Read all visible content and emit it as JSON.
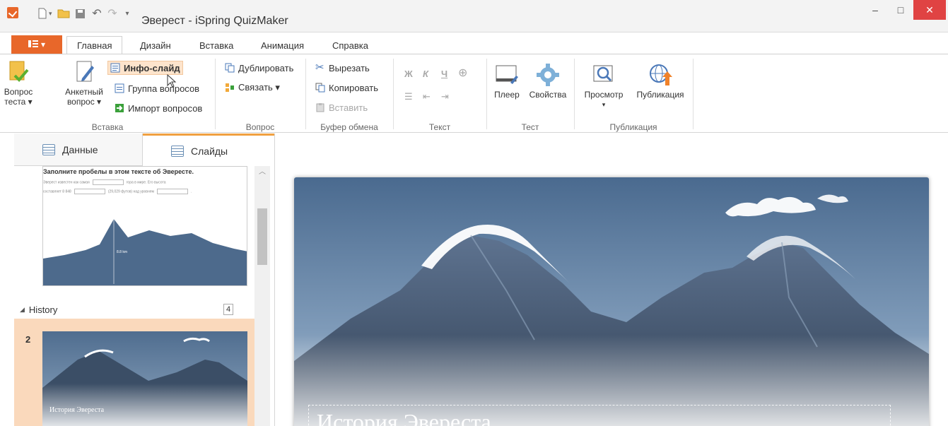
{
  "window": {
    "title": "Эверест - iSpring QuizMaker",
    "minimize_glyph": "–",
    "maximize_glyph": "□",
    "close_glyph": "✕"
  },
  "quick_access": [
    "new-file-icon",
    "open-folder-icon",
    "save-icon",
    "undo-icon",
    "redo-icon",
    "customize-icon"
  ],
  "ribbon": {
    "file_button_glyph": "▾",
    "tabs": [
      "Главная",
      "Дизайн",
      "Вставка",
      "Анимация",
      "Справка"
    ],
    "active_tab": "Главная",
    "groups": {
      "insert": {
        "label": "Вставка",
        "quiz_question_line1": "Вопрос",
        "quiz_question_line2": "теста ▾",
        "survey_question_line1": "Анкетный",
        "survey_question_line2": "вопрос ▾",
        "info_slide": "Инфо-слайд",
        "question_group": "Группа вопросов",
        "import_questions": "Импорт вопросов"
      },
      "question": {
        "label": "Вопрос",
        "duplicate": "Дублировать",
        "link": "Связать ▾"
      },
      "clipboard": {
        "label": "Буфер обмена",
        "cut": "Вырезать",
        "copy": "Копировать",
        "paste": "Вставить"
      },
      "text": {
        "label": "Текст",
        "bold": "Ж",
        "italic": "К",
        "underline": "Ч"
      },
      "test": {
        "label": "Тест",
        "player": "Плеер",
        "properties": "Свойства"
      },
      "publish": {
        "label": "Публикация",
        "preview": "Просмотр",
        "preview_arrow": "▾",
        "publish": "Публикация"
      }
    }
  },
  "left_panel": {
    "tabs": [
      "Данные",
      "Слайды"
    ],
    "active_tab": "Слайды",
    "slide1": {
      "title": "Заполните пробелы в этом тексте об Эвересте.",
      "line1_a": "Эверест известен как самая",
      "line1_b": "гора в мире. Его высота",
      "line2_a": "составляет 8 848",
      "line2_b": "(29,029 футов) над уровнем",
      "line2_c": ".",
      "height_label": "8.8 km"
    },
    "section": {
      "name": "History",
      "count": "4"
    },
    "slide2": {
      "number": "2",
      "caption": "История Эвереста"
    }
  },
  "main_slide": {
    "title": "История Эвереста"
  },
  "colors": {
    "accent": "#e8672a",
    "selected_slide": "#fad9bc",
    "active_panel_tab_border": "#f0a040",
    "close_button": "#e04343"
  }
}
